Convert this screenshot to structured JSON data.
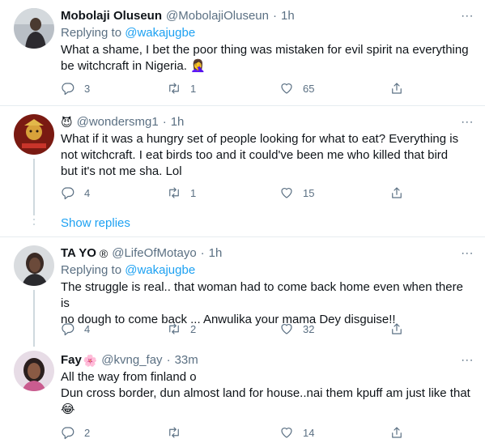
{
  "tweets": [
    {
      "name": "Mobolaji Oluseun",
      "handle": "@MobolajiOluseun",
      "time": "1h",
      "replying_label": "Replying to",
      "replying_to": "@wakajugbe",
      "text": "What a shame, I bet the poor thing was mistaken for evil spirit na everything\nbe witchcraft in Nigeria.  🤦‍♀️",
      "replies": "3",
      "retweets": "1",
      "likes": "65"
    },
    {
      "name": "",
      "badge": "😈",
      "handle": "@wondersmg1",
      "time": "1h",
      "text": "What if it was a hungry set of people looking for what to eat? Everything is\nnot witchcraft. I eat birds too and it could've been me who killed that bird\nbut it's not me sha. Lol",
      "replies": "4",
      "retweets": "1",
      "likes": "15"
    },
    {
      "name": "TA YO",
      "badge": "®",
      "handle": "@LifeOfMotayo",
      "time": "1h",
      "replying_label": "Replying to",
      "replying_to": "@wakajugbe",
      "text": "The struggle is real.. that woman had to come back home even when there is\nno dough to come back ... Anwulika your mama Dey disguise!!",
      "replies": "4",
      "retweets": "2",
      "likes": "32"
    },
    {
      "name": "Fay",
      "badge": "🌸",
      "handle": "@kvng_fay",
      "time": "33m",
      "text": "All the way from finland o\nDun cross border, dun almost land for house..nai them kpuff am just like that\n😂",
      "replies": "2",
      "retweets": "",
      "likes": "14"
    }
  ],
  "show_replies": "Show replies",
  "dot": "·",
  "more": "∙∙∙"
}
